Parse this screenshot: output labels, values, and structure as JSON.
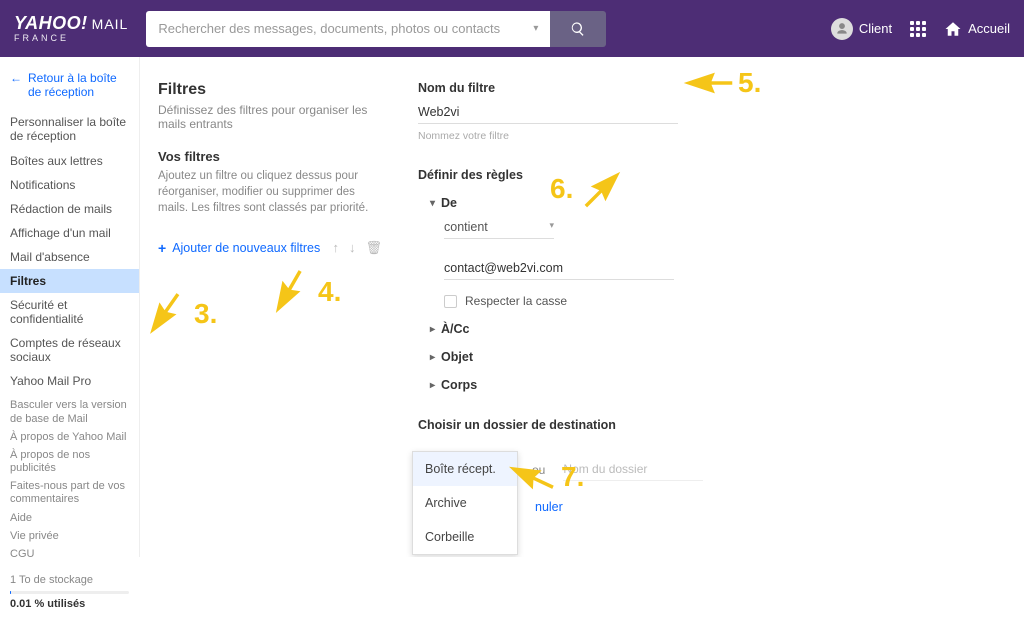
{
  "header": {
    "logo_main": "YAHOO!",
    "logo_mail": "MAIL",
    "logo_sub": "FRANCE",
    "search_placeholder": "Rechercher des messages, documents, photos ou contacts",
    "client_label": "Client",
    "home_label": "Accueil"
  },
  "sidebar": {
    "back_label": "Retour à la boîte de réception",
    "items": [
      "Personnaliser la boîte de réception",
      "Boîtes aux lettres",
      "Notifications",
      "Rédaction de mails",
      "Affichage d'un mail",
      "Mail d'absence",
      "Filtres",
      "Sécurité et confidentialité",
      "Comptes de réseaux sociaux",
      "Yahoo Mail Pro"
    ],
    "active_index": 6,
    "footer": [
      "Basculer vers la version de base de Mail",
      "À propos de Yahoo Mail",
      "À propos de nos publicités",
      "Faites-nous part de vos commentaires",
      "Aide",
      "Vie privée",
      "CGU"
    ],
    "storage_line1": "1 To de stockage",
    "storage_line2": "0.01 % utilisés"
  },
  "mid": {
    "title": "Filtres",
    "subtitle": "Définissez des filtres pour organiser les mails entrants",
    "h2": "Vos filtres",
    "desc": "Ajoutez un filtre ou cliquez dessus pour réorganiser, modifier ou supprimer des mails. Les filtres sont classés par priorité.",
    "add_label": "Ajouter de nouveaux filtres"
  },
  "main": {
    "name_label": "Nom du filtre",
    "name_value": "Web2vi",
    "name_help": "Nommez votre filtre",
    "rules_label": "Définir des règles",
    "rule_de": "De",
    "op_contains": "contient",
    "from_value": "contact@web2vi.com",
    "case_label": "Respecter la casse",
    "rule_acc": "À/Cc",
    "rule_obj": "Objet",
    "rule_corps": "Corps",
    "dest_label": "Choisir un dossier de destination",
    "dest_selected": "Boîte récept.",
    "dest_or": "ou",
    "dest_new_placeholder": "Nom du dossier",
    "dropdown": [
      "Boîte récept.",
      "Archive",
      "Corbeille"
    ],
    "cancel": "nuler"
  },
  "annotations": {
    "n3": "3.",
    "n4": "4.",
    "n5": "5.",
    "n6": "6.",
    "n7": "7."
  }
}
